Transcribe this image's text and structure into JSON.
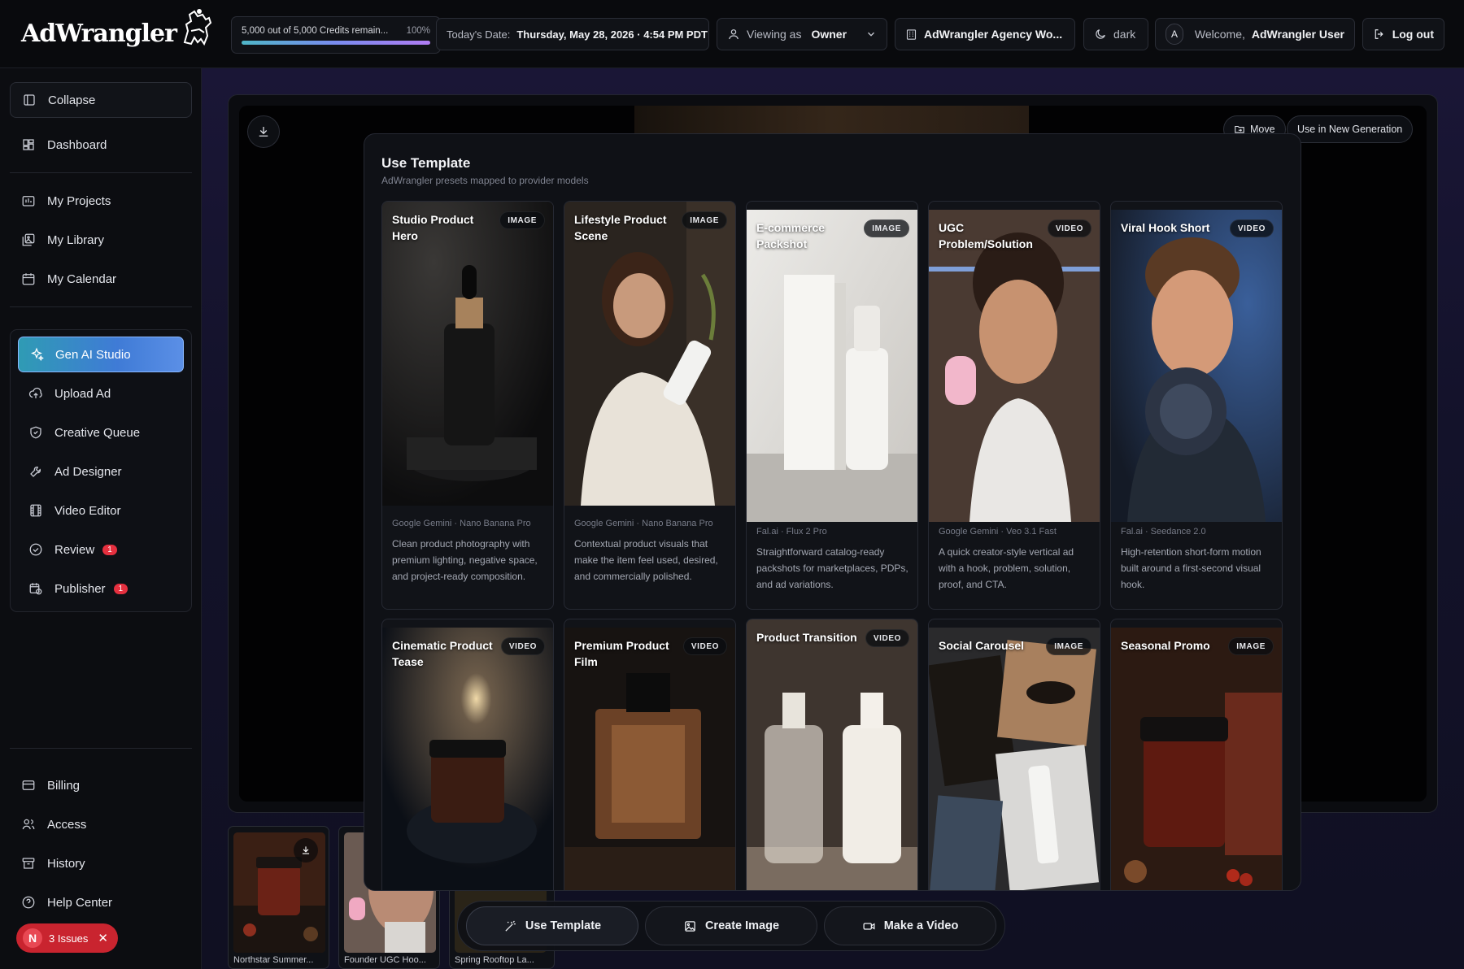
{
  "header": {
    "brand": "AdWrangler",
    "credits": {
      "text": "5,000 out of 5,000 Credits remain...",
      "percent_label": "100%",
      "fraction": 1.0
    },
    "date_label": "Today's Date:",
    "date_value": "Thursday, May 28, 2026 · 4:54 PM PDT",
    "viewing_label": "Viewing as",
    "viewing_value": "Owner",
    "workspace": "AdWrangler Agency Wo...",
    "theme": "dark",
    "avatar_letter": "A",
    "welcome_label": "Welcome,",
    "welcome_user": "AdWrangler User",
    "logout": "Log out"
  },
  "sidebar": {
    "collapse": "Collapse",
    "top_items": [
      {
        "label": "Dashboard",
        "icon": "dashboard-icon"
      },
      {
        "label": "My Projects",
        "icon": "projects-icon"
      },
      {
        "label": "My Library",
        "icon": "library-icon"
      },
      {
        "label": "My Calendar",
        "icon": "calendar-icon"
      }
    ],
    "studio_items": [
      {
        "label": "Gen AI Studio",
        "icon": "sparkles-icon",
        "active": true
      },
      {
        "label": "Upload Ad",
        "icon": "upload-cloud-icon"
      },
      {
        "label": "Creative Queue",
        "icon": "shield-icon"
      },
      {
        "label": "Ad Designer",
        "icon": "wrench-icon"
      },
      {
        "label": "Video Editor",
        "icon": "film-icon"
      },
      {
        "label": "Review",
        "icon": "check-circle-icon",
        "badge": "1"
      },
      {
        "label": "Publisher",
        "icon": "calendar-clock-icon",
        "badge": "1"
      }
    ],
    "bottom_items": [
      {
        "label": "Billing",
        "icon": "credit-card-icon"
      },
      {
        "label": "Access",
        "icon": "users-icon"
      },
      {
        "label": "History",
        "icon": "archive-icon"
      },
      {
        "label": "Help Center",
        "icon": "help-circle-icon"
      }
    ],
    "issues": {
      "letter": "N",
      "label": "3 Issues"
    }
  },
  "canvas": {
    "move": "Move",
    "use_new": "Use in New Generation"
  },
  "modal": {
    "title": "Use Template",
    "subtitle": "AdWrangler presets mapped to provider models",
    "cards": [
      {
        "title": "Studio Product Hero",
        "type": "IMAGE",
        "model": "Google Gemini · Nano Banana Pro",
        "desc": "Clean product photography with premium lighting, negative space, and project-ready composition."
      },
      {
        "title": "Lifestyle Product Scene",
        "type": "IMAGE",
        "model": "Google Gemini · Nano Banana Pro",
        "desc": "Contextual product visuals that make the item feel used, desired, and commercially polished."
      },
      {
        "title": "E-commerce Packshot",
        "type": "IMAGE",
        "model": "Fal.ai · Flux 2 Pro",
        "desc": "Straightforward catalog-ready packshots for marketplaces, PDPs, and ad variations."
      },
      {
        "title": "UGC Problem/Solution",
        "type": "VIDEO",
        "model": "Google Gemini · Veo 3.1 Fast",
        "desc": "A quick creator-style vertical ad with a hook, problem, solution, proof, and CTA."
      },
      {
        "title": "Viral Hook Short",
        "type": "VIDEO",
        "model": "Fal.ai · Seedance 2.0",
        "desc": "High-retention short-form motion built around a first-second visual hook."
      },
      {
        "title": "Cinematic Product Tease",
        "type": "VIDEO"
      },
      {
        "title": "Premium Product Film",
        "type": "VIDEO"
      },
      {
        "title": "Product Transition",
        "type": "VIDEO"
      },
      {
        "title": "Social Carousel",
        "type": "IMAGE"
      },
      {
        "title": "Seasonal Promo",
        "type": "IMAGE"
      }
    ]
  },
  "thumbnails": [
    {
      "caption": "Northstar Summer..."
    },
    {
      "caption": "Founder UGC Hoo..."
    },
    {
      "caption": "Spring Rooftop La..."
    }
  ],
  "actions": {
    "use_template": "Use Template",
    "create_image": "Create Image",
    "make_video": "Make a Video"
  }
}
